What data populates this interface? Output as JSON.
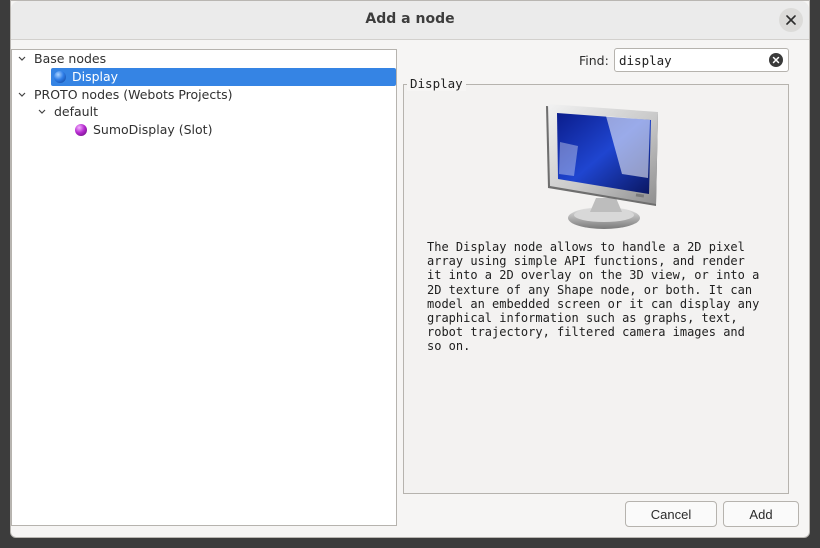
{
  "window": {
    "title": "Add a node"
  },
  "tree": {
    "base": {
      "label": "Base nodes",
      "expanded": true
    },
    "display": {
      "label": "Display",
      "selected": true,
      "color": "#1f6fd6"
    },
    "proto": {
      "label": "PROTO nodes (Webots Projects)",
      "expanded": true
    },
    "default": {
      "label": "default",
      "expanded": true
    },
    "sumo": {
      "label": "SumoDisplay (Slot)",
      "color": "#9b1fb0"
    }
  },
  "find": {
    "label": "Find:",
    "value": "display"
  },
  "details": {
    "legend": "Display",
    "description": "The Display node allows to handle a 2D pixel\narray using simple API functions, and render\nit into a 2D overlay on the 3D view, or into a\n2D texture of any Shape node, or both. It can\nmodel an embedded screen or it can display any\ngraphical information such as graphs, text,\nrobot trajectory, filtered camera images and\nso on.",
    "image": "monitor-icon"
  },
  "buttons": {
    "cancel": "Cancel",
    "add": "Add"
  },
  "colors": {
    "selection": "#3584e4"
  }
}
